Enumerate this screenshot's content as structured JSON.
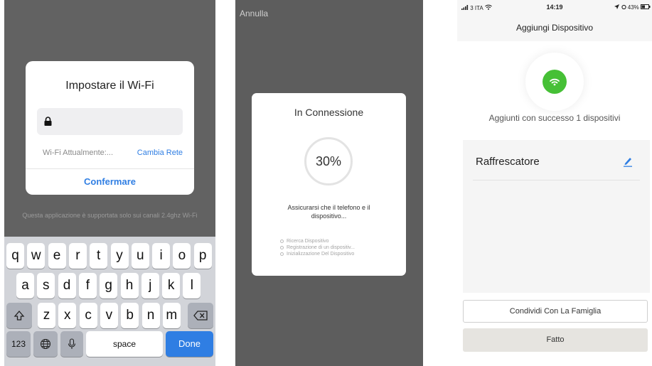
{
  "screen1": {
    "dialog_title": "Impostare il Wi-Fi",
    "password_value": "",
    "current_wifi_label": "Wi-Fi Attualmente:...",
    "change_network": "Cambia Rete",
    "confirm_button": "Confermare",
    "note": "Questa applicazione è supportata solo sui canali 2.4ghz Wi-Fi",
    "keyboard": {
      "row1": [
        "q",
        "w",
        "e",
        "r",
        "t",
        "y",
        "u",
        "i",
        "o",
        "p"
      ],
      "row2": [
        "a",
        "s",
        "d",
        "f",
        "g",
        "h",
        "j",
        "k",
        "l"
      ],
      "row3": [
        "z",
        "x",
        "c",
        "v",
        "b",
        "n",
        "m"
      ],
      "numbers_key": "123",
      "space_key": "space",
      "done_key": "Done"
    }
  },
  "screen2": {
    "cancel": "Annulla",
    "dialog_title": "In Connessione",
    "progress_label": "30%",
    "progress": 0.3,
    "message": "Assicurarsi che il telefono e il dispositivo...",
    "steps": [
      "Ricerca Dispositivo",
      "Registrazione di un dispositiv...",
      "Inizializzazione Del Dispositivo"
    ]
  },
  "screen3": {
    "status": {
      "carrier": "3 ITA",
      "time": "14:19",
      "battery": "43%"
    },
    "nav_title": "Aggiungi Dispositivo",
    "success_text": "Aggiunti con successo 1 dispositivi",
    "device_name": "Raffrescatore",
    "share_button": "Condividi Con La Famiglia",
    "done_button": "Fatto"
  },
  "colors": {
    "accent": "#2f7ee3",
    "success": "#46c036",
    "overlay": "#626262"
  }
}
